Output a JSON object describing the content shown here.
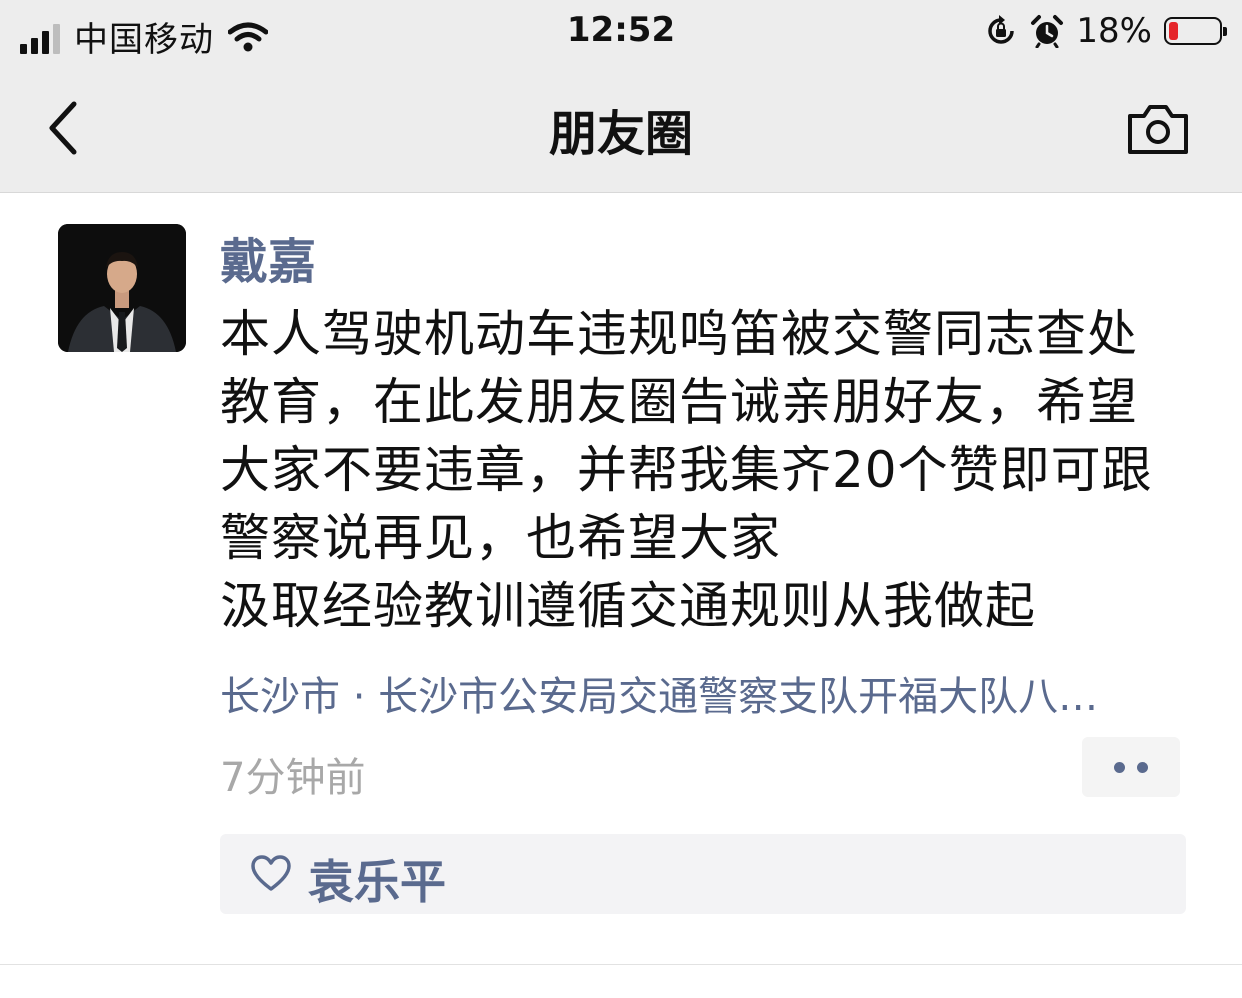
{
  "status_bar": {
    "carrier": "中国移动",
    "time": "12:52",
    "battery_percent_text": "18%",
    "battery_level": 0.18,
    "icons": [
      "signal-icon",
      "wifi-icon",
      "orientation-lock-icon",
      "alarm-icon",
      "battery-icon"
    ]
  },
  "nav": {
    "title": "朋友圈",
    "back_icon": "chevron-left-icon",
    "camera_icon": "camera-icon"
  },
  "post": {
    "author": "戴嘉",
    "text_lines": [
      "本人驾驶机动车违规鸣笛被交警同志查处",
      "教育，在此发朋友圈告诫亲朋好友，希望",
      "大家不要违章，并帮我集齐20个赞即可跟",
      "警察说再见，也希望大家",
      "汲取经验教训遵循交通规则从我做起"
    ],
    "location": "长沙市 · 长沙市公安局交通警察支队开福大队八…",
    "timestamp": "7分钟前",
    "likes": [
      "袁乐平"
    ]
  },
  "colors": {
    "name_blue": "#5a6a8e",
    "header_bg": "#ededed",
    "likes_bg": "#f3f3f5",
    "battery_red": "#e5252a"
  }
}
